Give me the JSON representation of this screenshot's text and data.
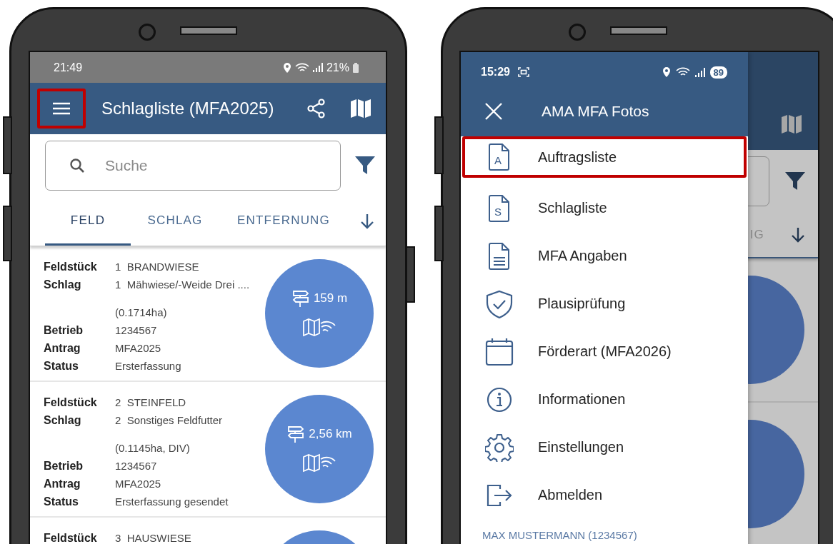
{
  "left_phone": {
    "status_bar": {
      "time": "21:49",
      "battery": "21%"
    },
    "app_bar": {
      "menu_highlighted": true,
      "title": "Schlagliste (MFA2025)"
    },
    "search": {
      "placeholder": "Suche"
    },
    "tabs": [
      {
        "label": "FELD",
        "selected": true
      },
      {
        "label": "SCHLAG",
        "selected": false
      },
      {
        "label": "ENTFERNUNG",
        "selected": false
      }
    ],
    "fields": [
      {
        "rows": [
          {
            "label": "Feldstück",
            "value": "1  BRANDWIESE"
          },
          {
            "label": "Schlag",
            "value": "1  Mähwiese/-Weide Drei ...."
          },
          {
            "value": "(0.1714ha)"
          },
          {
            "label": "Betrieb",
            "value": "1234567"
          },
          {
            "label": "Antrag",
            "value": "MFA2025"
          },
          {
            "label": "Status",
            "value": "Ersterfassung"
          }
        ],
        "distance": "159 m"
      },
      {
        "rows": [
          {
            "label": "Feldstück",
            "value": "2  STEINFELD"
          },
          {
            "label": "Schlag",
            "value": "2  Sonstiges Feldfutter"
          },
          {
            "value": "(0.1145ha, DIV)"
          },
          {
            "label": "Betrieb",
            "value": "1234567"
          },
          {
            "label": "Antrag",
            "value": "MFA2025"
          },
          {
            "label": "Status",
            "value": "Ersterfassung gesendet"
          }
        ],
        "distance": "2,56 km"
      },
      {
        "rows": [
          {
            "label": "Feldstück",
            "value": "3  HAUSWIESE"
          }
        ]
      }
    ]
  },
  "right_phone": {
    "status_bar": {
      "time": "15:29",
      "battery": "89"
    },
    "background": {
      "tab_fragment": "IG"
    },
    "drawer": {
      "title": "AMA MFA Fotos",
      "items": [
        {
          "label": "Auftragsliste",
          "letter": "A",
          "highlighted": true
        },
        {
          "label": "Schlagliste",
          "letter": "S",
          "highlighted": false
        },
        {
          "label": "MFA Angaben",
          "highlighted": false
        },
        {
          "label": "Plausiprüfung",
          "highlighted": false
        },
        {
          "label": "Förderart (MFA2026)",
          "highlighted": false
        },
        {
          "label": "Informationen",
          "highlighted": false
        },
        {
          "label": "Einstellungen",
          "highlighted": false
        },
        {
          "label": "Abmelden",
          "highlighted": false
        }
      ],
      "user": "MAX MUSTERMANN (1234567)"
    }
  }
}
